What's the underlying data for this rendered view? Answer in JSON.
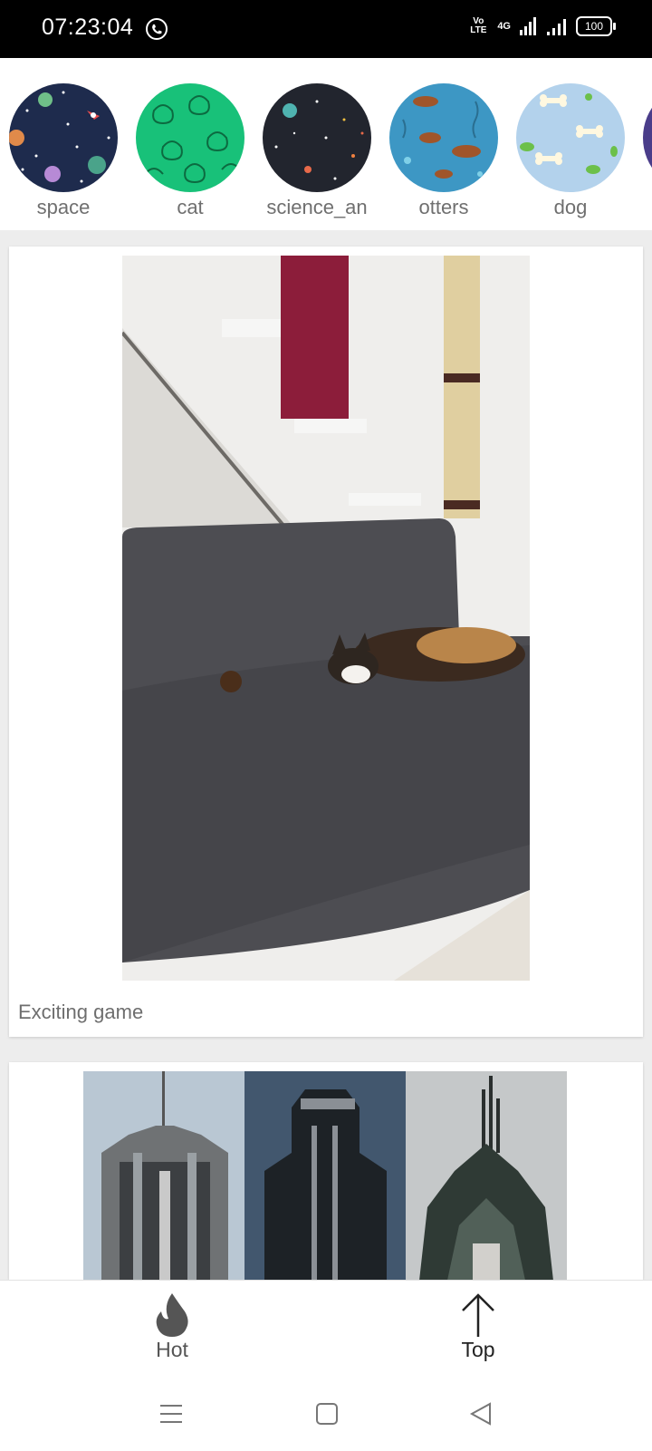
{
  "status_bar": {
    "time": "07:23:04",
    "volte": "Vo LTE",
    "network": "4G",
    "battery": "100"
  },
  "categories": [
    {
      "label": "space",
      "icon": "space-pattern"
    },
    {
      "label": "cat",
      "icon": "cat-pattern"
    },
    {
      "label": "science_an",
      "icon": "science-pattern"
    },
    {
      "label": "otters",
      "icon": "otter-pattern"
    },
    {
      "label": "dog",
      "icon": "dog-bone-pattern"
    }
  ],
  "feed": {
    "posts": [
      {
        "caption": "Exciting game",
        "media": "video-cat-on-sofa"
      },
      {
        "media": "photo-art-deco-towers"
      }
    ]
  },
  "bottom_nav": {
    "hot_label": "Hot",
    "top_label": "Top"
  },
  "colors": {
    "status_bar": "#000000",
    "cat_green": "#18c179",
    "space_navy": "#1e2b4d",
    "otter_blue": "#3d97c4",
    "dog_lightblue": "#b3d2ec"
  }
}
